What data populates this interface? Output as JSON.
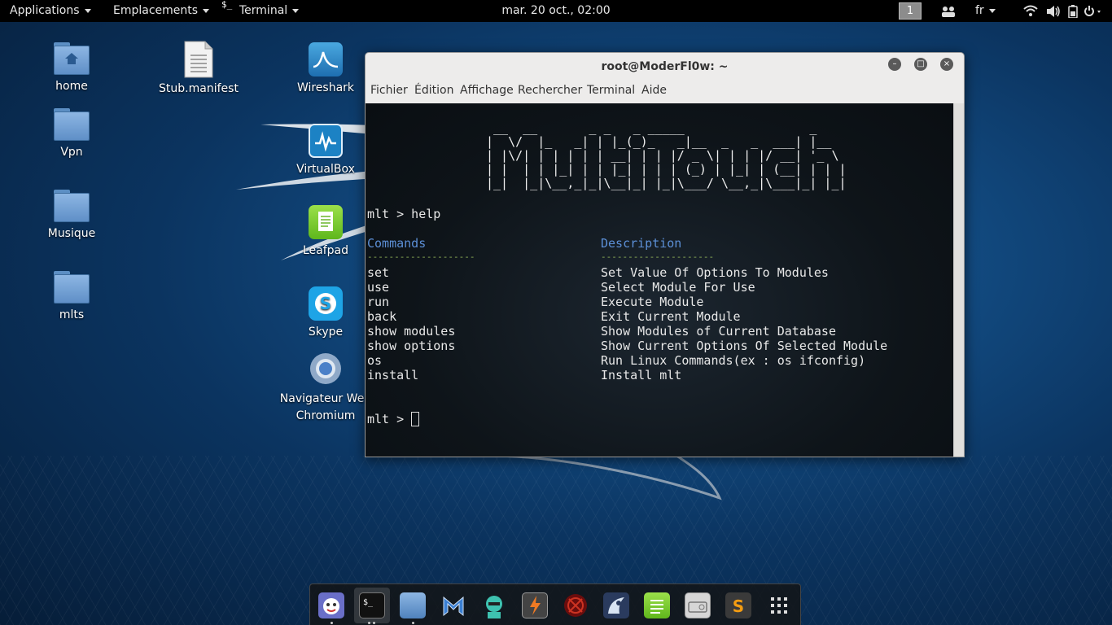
{
  "top_panel": {
    "applications": "Applications",
    "places": "Emplacements",
    "terminal": "Terminal",
    "terminal_icon": "$_",
    "clock": "mar. 20 oct., 02:00",
    "workspace": "1",
    "language": "fr",
    "icons": [
      "people-icon",
      "wifi-icon",
      "volume-icon",
      "battery-icon",
      "power-icon"
    ]
  },
  "desktop": {
    "left_column": [
      {
        "label": "home",
        "icon": "home-folder-icon"
      },
      {
        "label": "Vpn",
        "icon": "folder-icon"
      },
      {
        "label": "Musique",
        "icon": "folder-icon"
      },
      {
        "label": "mlts",
        "icon": "folder-icon"
      }
    ],
    "stub": {
      "label": "Stub.manifest",
      "icon": "text-file-icon"
    },
    "apps_column": [
      {
        "label": "Wireshark",
        "icon": "wireshark-icon"
      },
      {
        "label": "VirtualBox",
        "icon": "virtualbox-icon"
      },
      {
        "label": "Leafpad",
        "icon": "leafpad-icon"
      },
      {
        "label": "Skype",
        "icon": "skype-icon"
      },
      {
        "label": "Navigateur Web Chromium",
        "label_line1": "Navigateur Web",
        "label_line2": "Chromium",
        "icon": "chromium-icon"
      }
    ]
  },
  "window": {
    "title": "root@ModerFl0w: ~",
    "menu": [
      "Fichier",
      "Édition",
      "Affichage",
      "Rechercher",
      "Terminal",
      "Aide"
    ],
    "buttons": {
      "minimize": "–",
      "maximize": "□",
      "close": "×"
    }
  },
  "terminal": {
    "banner": [
      " __  __       _ _   _ _____                 _     ",
      "|  \\/  |_   _| | |_(_)_   _|__  _   _  ___| |__  ",
      "| |\\/| | | | | | __| | | |/ _ \\| | | |/ __| '_ \\ ",
      "| |  | | |_| | | |_| | | | (_) | |_| | (__| | | |",
      "|_|  |_|\\__,_|_|\\__|_| |_|\\___/ \\__,_|\\___|_| |_|"
    ],
    "prompt1": "mlt > help",
    "header_commands": "Commands",
    "header_description": "Description",
    "dashes_left": "--------------------",
    "dashes_right": "---------------------",
    "rows": [
      {
        "cmd": "set",
        "desc": "Set Value Of Options To Modules"
      },
      {
        "cmd": "use",
        "desc": "Select Module For Use"
      },
      {
        "cmd": "run",
        "desc": "Execute Module"
      },
      {
        "cmd": "back",
        "desc": "Exit Current Module"
      },
      {
        "cmd": "show modules",
        "desc": "Show Modules of Current Database"
      },
      {
        "cmd": "show options",
        "desc": "Show Current Options Of Selected Module"
      },
      {
        "cmd": "os",
        "desc": "Run Linux Commands(ex : os ifconfig)"
      },
      {
        "cmd": "install",
        "desc": "Install mlt"
      }
    ],
    "prompt2": "mlt > "
  },
  "dock": {
    "items": [
      "cherrytree-icon",
      "terminal-icon",
      "files-icon",
      "metasploit-icon",
      "armitage-icon",
      "burpsuite-icon",
      "faraday-icon",
      "maltego-icon",
      "leafpad-icon",
      "keyboard-icon",
      "sublime-icon",
      "app-grid-icon"
    ]
  },
  "colors": {
    "panel_bg": "#000000",
    "terminal_bg": "#0e1419",
    "terminal_header": "#5c8fd6",
    "terminal_dashes": "#96b85a"
  }
}
